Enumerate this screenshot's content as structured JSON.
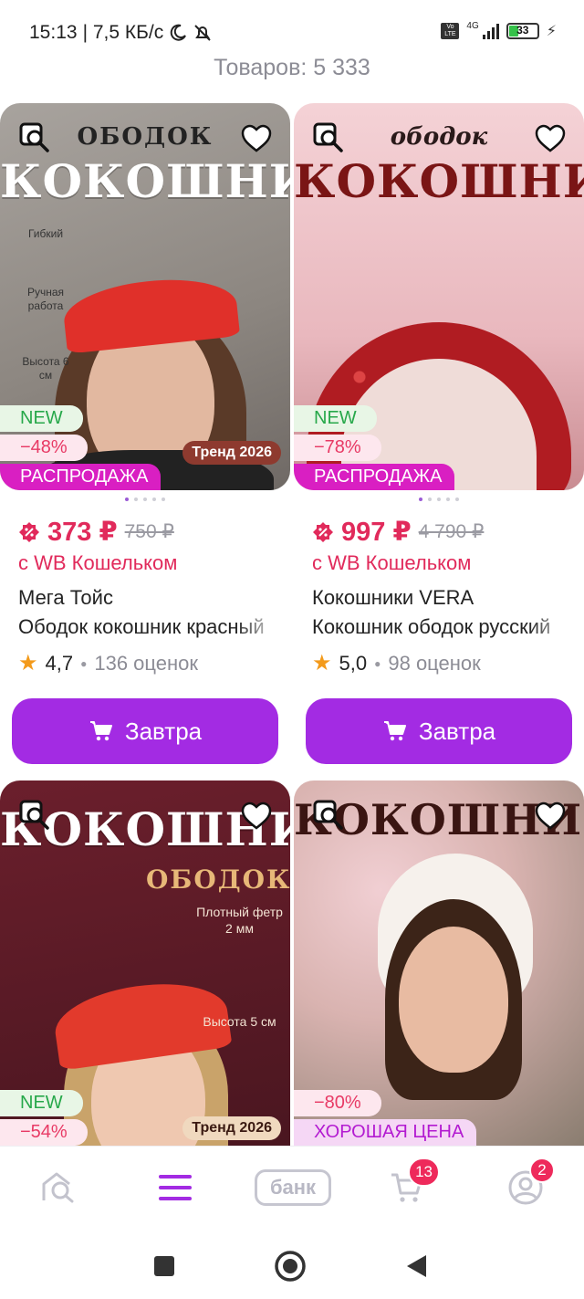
{
  "status_bar": {
    "time": "15:13",
    "speed": "| 7,5 КБ/с",
    "network": "4G",
    "volte": "Vo LTE",
    "battery": "33"
  },
  "header": {
    "count_text": "Товаров: 5 333"
  },
  "products": [
    {
      "photo": {
        "title_small": "ОБОДОК",
        "title_big": "КОКОШНИК",
        "side_1": "Гибкий",
        "side_2": "Ручная работа",
        "side_3": "Высота 6 см",
        "trend": "Тренд 2026"
      },
      "badges": {
        "new": "NEW",
        "discount": "−48%",
        "promo": "РАСПРОДАЖА"
      },
      "price": "373 ₽",
      "old_price": "750 ₽",
      "wallet": "с WB Кошельком",
      "brand": "Мега Тойс",
      "name": "Ободок кокошник красный",
      "rating": "4,7",
      "reviews": "136 оценок",
      "button": "Завтра"
    },
    {
      "photo": {
        "title_small": "ободок",
        "title_big": "КОКОШНИК"
      },
      "badges": {
        "new": "NEW",
        "discount": "−78%",
        "promo": "РАСПРОДАЖА"
      },
      "price": "997 ₽",
      "old_price": "4 790 ₽",
      "wallet": "с WB Кошельком",
      "brand": "Кокошники VERA",
      "name": "Кокошник ободок русский",
      "rating": "5,0",
      "reviews": "98 оценок",
      "button": "Завтра"
    },
    {
      "photo": {
        "title_small": "ОБОДОК",
        "title_big": "КОКОШНИК",
        "side_1": "Плотный фетр 2 мм",
        "side_2": "Высота 5 см",
        "trend": "Тренд 2026"
      },
      "badges": {
        "new": "NEW",
        "discount": "−54%"
      }
    },
    {
      "photo": {
        "title_big": "КОКОШНИК"
      },
      "badges": {
        "discount": "−80%",
        "promo": "ХОРОШАЯ ЦЕНА"
      }
    }
  ],
  "bottom_nav": {
    "bank_label": "банк",
    "cart_count": "13",
    "profile_count": "2"
  },
  "colors": {
    "accent": "#a32be3",
    "price": "#e12a5b",
    "sale_badge": "#d91fc2",
    "new_badge_text": "#27a84a"
  }
}
